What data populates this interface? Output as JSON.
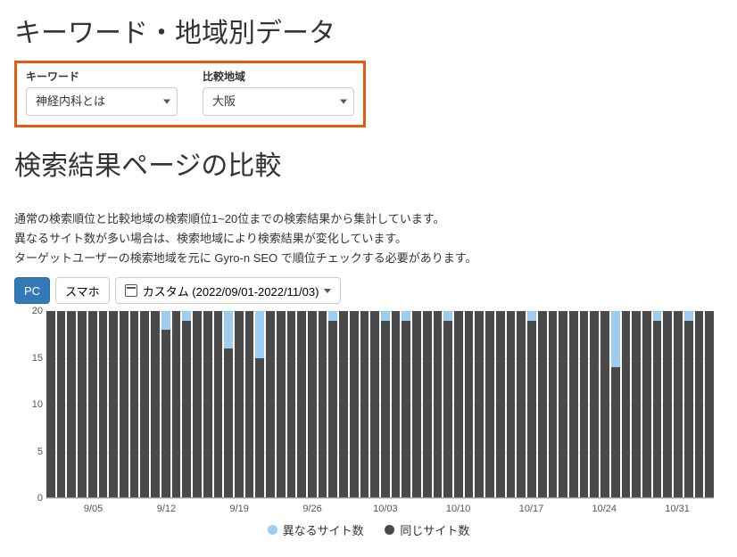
{
  "page_title": "キーワード・地域別データ",
  "filters": {
    "keyword_label": "キーワード",
    "keyword_value": "神経内科とは",
    "region_label": "比較地域",
    "region_value": "大阪"
  },
  "section_title": "検索結果ページの比較",
  "description": {
    "line1": "通常の検索順位と比較地域の検索順位1~20位までの検索結果から集計しています。",
    "line2": "異なるサイト数が多い場合は、検索地域により検索結果が変化しています。",
    "line3": "ターゲットユーザーの検索地域を元に Gyro-n SEO で順位チェックする必要があります。"
  },
  "controls": {
    "device_pc": "PC",
    "device_sp": "スマホ",
    "date_range": "カスタム (2022/09/01-2022/11/03)"
  },
  "legend": {
    "diff": "異なるサイト数",
    "same": "同じサイト数"
  },
  "chart_data": {
    "type": "bar",
    "ylabel": "",
    "xlabel": "",
    "ylim": [
      0,
      20
    ],
    "y_ticks": [
      0,
      5,
      10,
      15,
      20
    ],
    "x_tick_labels": [
      "9/05",
      "9/12",
      "9/19",
      "9/26",
      "10/03",
      "10/10",
      "10/17",
      "10/24",
      "10/31"
    ],
    "x_tick_indices": [
      4,
      11,
      18,
      25,
      32,
      39,
      46,
      53,
      60
    ],
    "categories_start": "2022-09-01",
    "categories_end": "2022-11-03",
    "series": [
      {
        "name": "同じサイト数",
        "values": [
          20,
          20,
          20,
          20,
          20,
          20,
          20,
          20,
          20,
          20,
          20,
          18,
          20,
          19,
          20,
          20,
          20,
          16,
          20,
          20,
          15,
          20,
          20,
          20,
          20,
          20,
          20,
          19,
          20,
          20,
          20,
          20,
          19,
          20,
          19,
          20,
          20,
          20,
          19,
          20,
          20,
          20,
          20,
          20,
          20,
          20,
          19,
          20,
          20,
          20,
          20,
          20,
          20,
          20,
          14,
          20,
          20,
          20,
          19,
          20,
          20,
          19,
          20,
          20
        ]
      },
      {
        "name": "異なるサイト数",
        "values": [
          0,
          0,
          0,
          0,
          0,
          0,
          0,
          0,
          0,
          0,
          0,
          2,
          0,
          1,
          0,
          0,
          0,
          4,
          0,
          0,
          5,
          0,
          0,
          0,
          0,
          0,
          0,
          1,
          0,
          0,
          0,
          0,
          1,
          0,
          1,
          0,
          0,
          0,
          1,
          0,
          0,
          0,
          0,
          0,
          0,
          0,
          1,
          0,
          0,
          0,
          0,
          0,
          0,
          0,
          6,
          0,
          0,
          0,
          1,
          0,
          0,
          1,
          0,
          0
        ]
      }
    ]
  }
}
